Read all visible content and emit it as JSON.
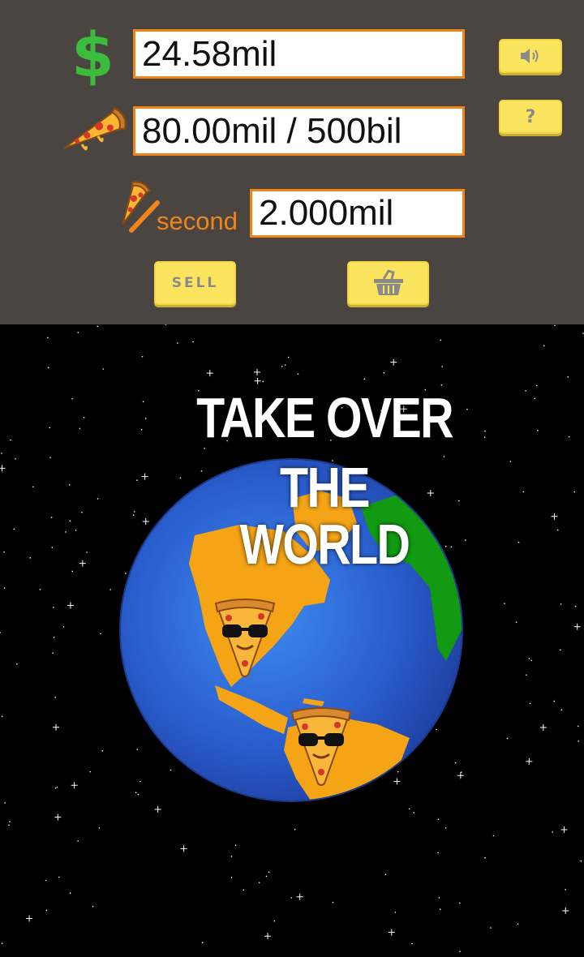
{
  "money": {
    "value": "24.58mil"
  },
  "pizzas": {
    "value": "80.00mil / 500bil"
  },
  "rate": {
    "label": "second",
    "value": "2.000mil"
  },
  "buttons": {
    "sell_label": "SELL",
    "help_label": "?"
  },
  "headline": {
    "line1": "TAKE OVER",
    "line2": "THE WORLD"
  },
  "icons": {
    "money": "dollar-icon",
    "pizza": "pizza-slice-icon",
    "rate": "pizza-per-second-icon",
    "sound": "speaker-icon",
    "shop": "shopping-basket-icon"
  },
  "colors": {
    "panel": "#4a4541",
    "accent_orange": "#f0861a",
    "button_yellow": "#fbe55e",
    "dollar_green": "#3cbc3c",
    "ocean_blue": "#2a5fd0",
    "land_orange": "#f5a416",
    "land_green": "#129a12"
  }
}
